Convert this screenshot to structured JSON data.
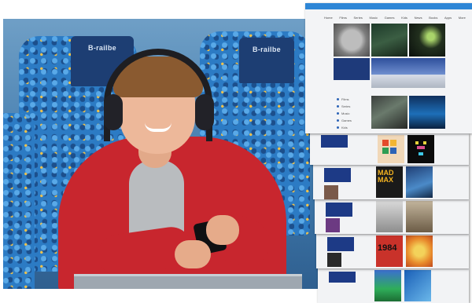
{
  "photo": {
    "seat_logo_1": "B-railbe",
    "seat_logo_2": "B-railbe"
  },
  "website": {
    "nav_items": [
      "Home",
      "Films",
      "Series",
      "Music",
      "Games",
      "Kids",
      "News",
      "Books",
      "Apps",
      "More"
    ],
    "menu_items": [
      "Films",
      "Series",
      "Music",
      "Games",
      "Kids"
    ],
    "posters": {
      "mad_max": "MAD MAX",
      "year_1984": "1984"
    }
  }
}
